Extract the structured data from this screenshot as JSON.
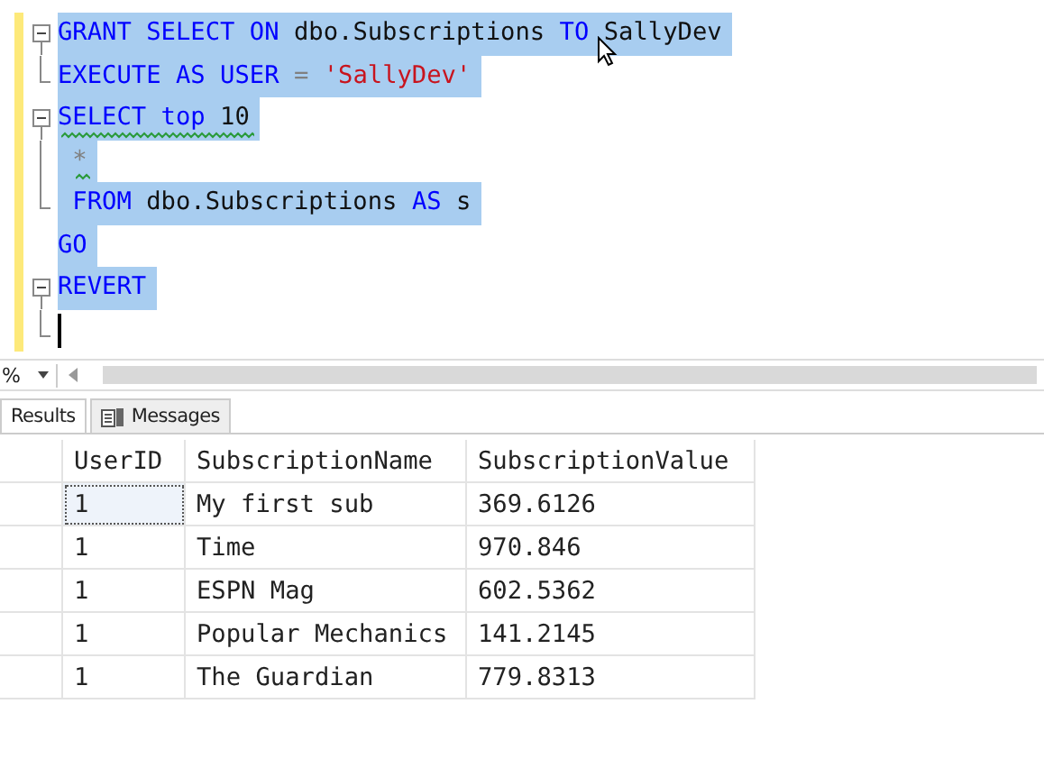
{
  "editor": {
    "lines": [
      {
        "kind": "fold-start",
        "squiggle": false,
        "selected": true,
        "tokens": [
          {
            "kind": "keyword",
            "text": "GRANT SELECT ON "
          },
          {
            "kind": "plain",
            "text": "dbo.Subscriptions "
          },
          {
            "kind": "keyword",
            "text": "TO "
          },
          {
            "kind": "plain",
            "text": "SallyDev"
          }
        ]
      },
      {
        "kind": "fold-end",
        "squiggle": false,
        "selected": true,
        "tokens": [
          {
            "kind": "keyword",
            "text": "EXECUTE AS USER "
          },
          {
            "kind": "operator",
            "text": "= "
          },
          {
            "kind": "string",
            "text": "'SallyDev'"
          }
        ]
      },
      {
        "kind": "fold-start",
        "squiggle": true,
        "selected": true,
        "tokens": [
          {
            "kind": "keyword",
            "text": "SELECT top "
          },
          {
            "kind": "plain",
            "text": "10"
          }
        ]
      },
      {
        "kind": "fold-middle",
        "squiggle": true,
        "selected": true,
        "tokens": [
          {
            "kind": "operator",
            "text": " *"
          }
        ]
      },
      {
        "kind": "fold-end",
        "squiggle": false,
        "selected": true,
        "tokens": [
          {
            "kind": "keyword",
            "text": " FROM "
          },
          {
            "kind": "plain",
            "text": "dbo.Subscriptions "
          },
          {
            "kind": "keyword",
            "text": "AS "
          },
          {
            "kind": "plain",
            "text": "s"
          }
        ]
      },
      {
        "kind": "plain",
        "squiggle": false,
        "selected": true,
        "tokens": [
          {
            "kind": "keyword",
            "text": "GO"
          }
        ]
      },
      {
        "kind": "fold-start",
        "squiggle": false,
        "selected": true,
        "tokens": [
          {
            "kind": "keyword",
            "text": "REVERT"
          }
        ]
      },
      {
        "kind": "fold-end",
        "cursor": true
      }
    ]
  },
  "zoom": {
    "value": "%"
  },
  "tabs": [
    {
      "label": "Results",
      "selected": true,
      "kind": "grid"
    },
    {
      "label": "Messages",
      "selected": false,
      "kind": "messages"
    }
  ],
  "table": {
    "columns": [
      "UserID",
      "SubscriptionName",
      "SubscriptionValue"
    ],
    "rows": [
      {
        "focused": true,
        "cells": [
          "1",
          "My first sub",
          "369.6126"
        ]
      },
      {
        "focused": false,
        "cells": [
          "1",
          "Time",
          "970.846"
        ]
      },
      {
        "focused": false,
        "cells": [
          "1",
          "ESPN Mag",
          "602.5362"
        ]
      },
      {
        "focused": false,
        "cells": [
          "1",
          "Popular Mechanics",
          "141.2145"
        ]
      },
      {
        "focused": false,
        "cells": [
          "1",
          "The Guardian",
          "779.8313"
        ]
      }
    ]
  }
}
